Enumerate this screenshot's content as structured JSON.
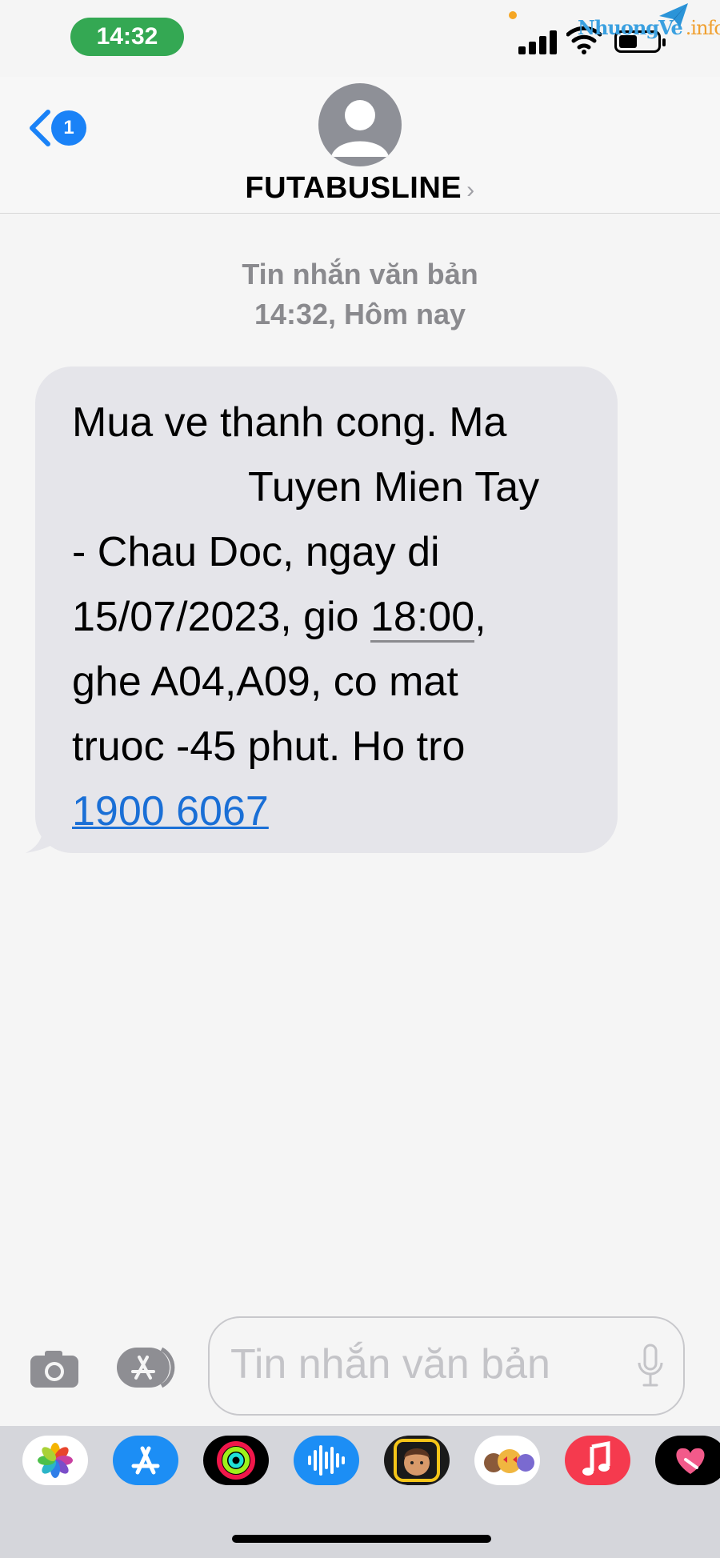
{
  "status_bar": {
    "time": "14:32",
    "icons": [
      "signal-icon",
      "wifi-icon",
      "battery-icon"
    ],
    "watermark_main": "NhuongVe",
    "watermark_suffix": ".info"
  },
  "header": {
    "back_badge_count": "1",
    "contact_name": "FUTABUSLINE",
    "contact_chevron": "›"
  },
  "thread": {
    "meta_type": "Tin nhắn văn bản",
    "meta_time": "14:32, Hôm nay",
    "message": {
      "line1": "Mua ve thanh cong. Ma",
      "line2": "Tuyen Mien Tay",
      "line3": "- Chau Doc, ngay di",
      "line4_a": "15/07/2023, gio ",
      "line4_time": "18:00",
      "line4_b": ",",
      "line5": "ghe A04,A09, co mat",
      "line6": "truoc -45 phut. Ho tro",
      "phone": "1900 6067"
    }
  },
  "composer": {
    "placeholder": "Tin nhắn văn bản"
  },
  "app_strip": {
    "apps": [
      "photos-app-icon",
      "app-store-app-icon",
      "fitness-app-icon",
      "audio-message-app-icon",
      "memoji-app-icon",
      "animoji-app-icon",
      "music-app-icon",
      "digital-touch-app-icon"
    ]
  },
  "colors": {
    "accent": "#1a82f7",
    "bubble": "#e5e5ea",
    "time_pill": "#34a853",
    "link": "#1a6fd6"
  }
}
